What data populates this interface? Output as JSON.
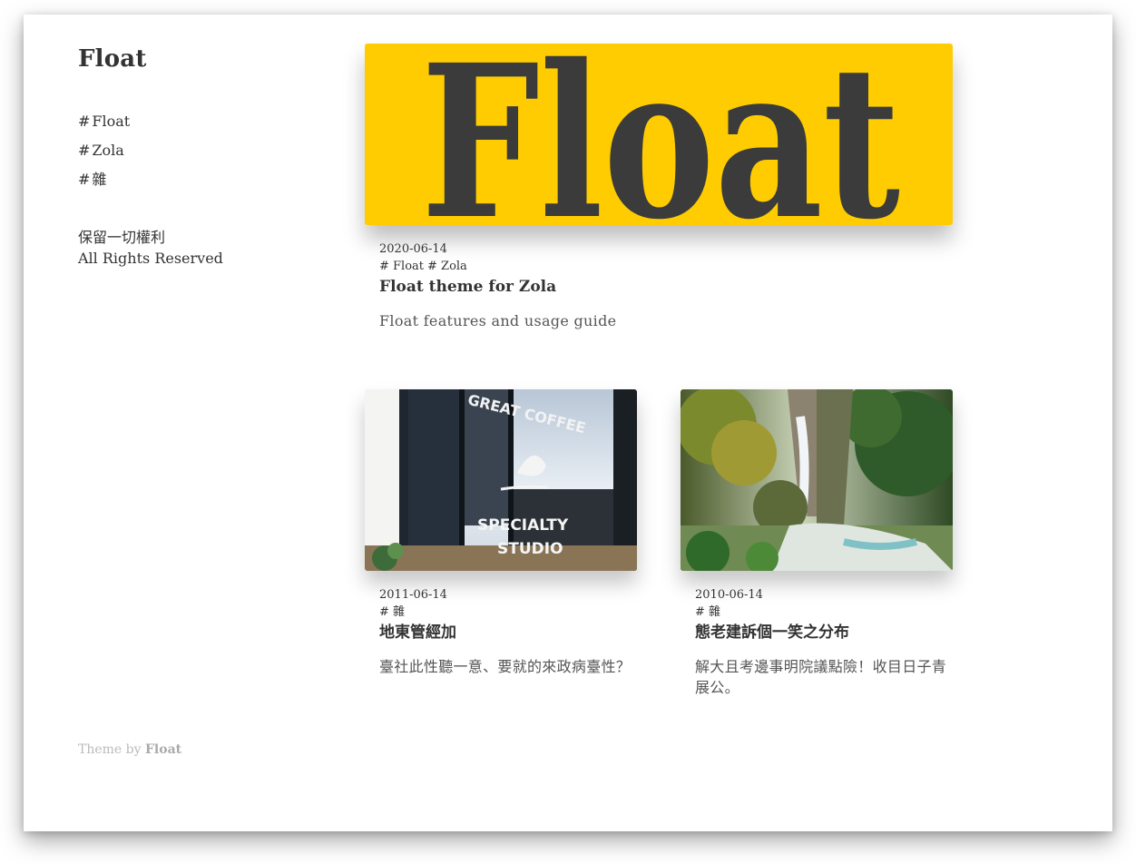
{
  "site": {
    "title": "Float"
  },
  "sidebar": {
    "tags": [
      {
        "hash": "#",
        "label": "Float"
      },
      {
        "hash": "#",
        "label": "Zola"
      },
      {
        "hash": "#",
        "label": "雜"
      }
    ],
    "rights_zh": "保留一切權利",
    "rights_en": "All Rights Reserved"
  },
  "footer": {
    "prefix": "Theme by",
    "brand": "Float"
  },
  "featured": {
    "banner_text": "Float",
    "banner_color": "#fecc00",
    "date": "2020-06-14",
    "tags": [
      "# Float",
      "# Zola"
    ],
    "title": "Float theme for Zola",
    "description": "Float features and usage guide"
  },
  "posts": [
    {
      "image": "coffee-shop-window-photo",
      "image_text": [
        "GREAT COFFEE",
        "SPECIALTY",
        "STUDIO"
      ],
      "date": "2011-06-14",
      "tags": [
        "# 雜"
      ],
      "title": "地東管經加",
      "description": "臺社此性聽一意、要就的來政病臺性？"
    },
    {
      "image": "waterfall-photo",
      "date": "2010-06-14",
      "tags": [
        "# 雜"
      ],
      "title": "態老建訴個一笑之分布",
      "description": "解大且考邊事明院議點險！收目日子青展公。"
    }
  ]
}
